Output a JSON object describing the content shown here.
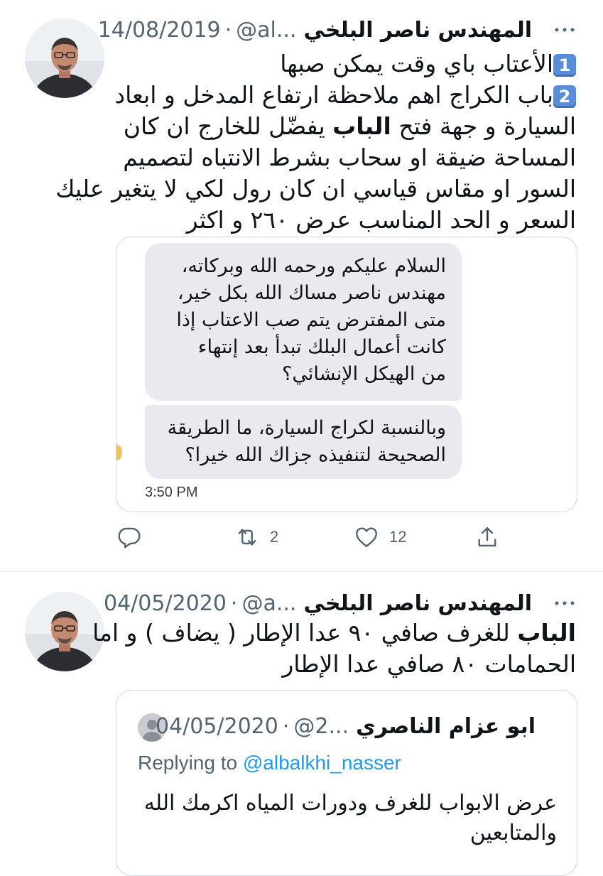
{
  "tweets": [
    {
      "author_name": "المهندس ناصر البلخي",
      "handle": "@al...",
      "separator": "·",
      "date": "14/08/2019",
      "more_icon": "more-horizontal-icon",
      "lines": {
        "l1_key": "1",
        "l1": "الأعتاب باي وقت يمكن صبها",
        "l2_key": "2",
        "l2": "باب الكراج اهم ملاحظة ارتفاع المدخل و ابعاد",
        "l3_a": "السيارة و جهة فتح ",
        "l3_bold": "الباب",
        "l3_b": " يفضّل للخارج ان كان",
        "l4": "المساحة ضيقة او سحاب بشرط الانتباه لتصميم",
        "l5": "السور او مقاس قياسي ان كان رول لكي لا يتغير عليك",
        "l6": "السعر و الحد المناسب  عرض ٢٦٠ و اكثر"
      },
      "media": {
        "bubble1": [
          "السلام عليكم ورحمه الله وبركاته،",
          "مهندس ناصر مساك الله بكل خير،",
          "متى المفترض يتم صب الاعتاب إذا",
          "كانت أعمال البلك تبدأ بعد إنتهاء",
          "من الهيكل الإنشائي؟"
        ],
        "bubble2": [
          "وبالنسبة لكراج السيارة، ما الطريقة",
          "الصحيحة لتنفيذه جزاك الله خيرا؟"
        ],
        "time": "3:50 PM"
      },
      "actions": {
        "reply_icon": "reply-icon",
        "retweet_icon": "retweet-icon",
        "retweet_count": "2",
        "like_icon": "heart-icon",
        "like_count": "12",
        "share_icon": "share-icon"
      }
    },
    {
      "author_name": "المهندس ناصر البلخي",
      "handle": "@a...",
      "separator": "·",
      "date": "04/05/2020",
      "more_icon": "more-horizontal-icon",
      "lines": {
        "l1_bold": "الباب",
        "l1": " للغرف صافي ٩٠ عدا الإطار ( يضاف )  و اما",
        "l2": "الحمامات ٨٠ صافي عدا الإطار"
      },
      "quote": {
        "author_name": "ابو عزام الناصري",
        "handle": "@2...",
        "separator": "·",
        "date": "04/05/2020",
        "replying_prefix": "Replying to ",
        "replying_mention": "@albalkhi_nasser",
        "lines": [
          "عرض الابواب للغرف ودورات المياه اكرمك الله",
          "والمتابعين"
        ]
      }
    }
  ],
  "colors": {
    "text": "#0f1419",
    "secondary": "#536471",
    "accent": "#1d9bf0",
    "border": "#cfd9de",
    "bubble": "#e9e9ef"
  }
}
